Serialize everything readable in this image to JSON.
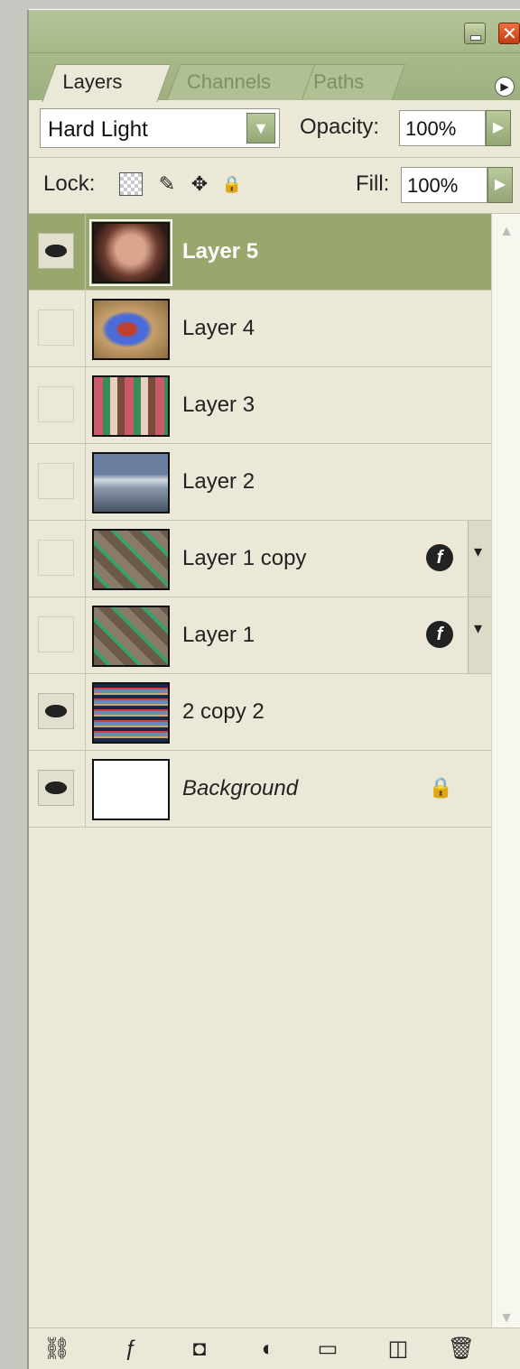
{
  "window": {
    "minimize_label": "",
    "close_label": ""
  },
  "tabs": [
    {
      "label": "Layers"
    },
    {
      "label": "Channels"
    },
    {
      "label": "Paths"
    }
  ],
  "panel_menu_icon": "triangle-right-circle-icon",
  "blend": {
    "mode": "Hard Light",
    "opacity_label": "Opacity:",
    "opacity_value": "100%"
  },
  "lock": {
    "label": "Lock:",
    "icons": [
      "lock-transparent-icon",
      "lock-paint-icon",
      "lock-move-icon",
      "lock-all-icon"
    ],
    "fill_label": "Fill:",
    "fill_value": "100%"
  },
  "layers": [
    {
      "name": "Layer 5",
      "visible": true,
      "selected": true
    },
    {
      "name": "Layer 4",
      "visible": false
    },
    {
      "name": "Layer 3",
      "visible": false
    },
    {
      "name": "Layer 2",
      "visible": false
    },
    {
      "name": "Layer 1 copy",
      "visible": false,
      "fx": true
    },
    {
      "name": "Layer 1",
      "visible": false,
      "fx": true
    },
    {
      "name": "2 copy 2",
      "visible": true
    },
    {
      "name": "Background",
      "visible": true,
      "locked": true
    }
  ],
  "footer_icons": [
    "link-layers-icon",
    "layer-style-icon",
    "layer-mask-icon",
    "adjustment-layer-icon",
    "new-group-icon",
    "new-layer-icon",
    "trash-icon"
  ],
  "colors": {
    "titlebar": "#a7b888",
    "panel_bg": "#ebe8d8",
    "selected_row": "#98a86c"
  }
}
